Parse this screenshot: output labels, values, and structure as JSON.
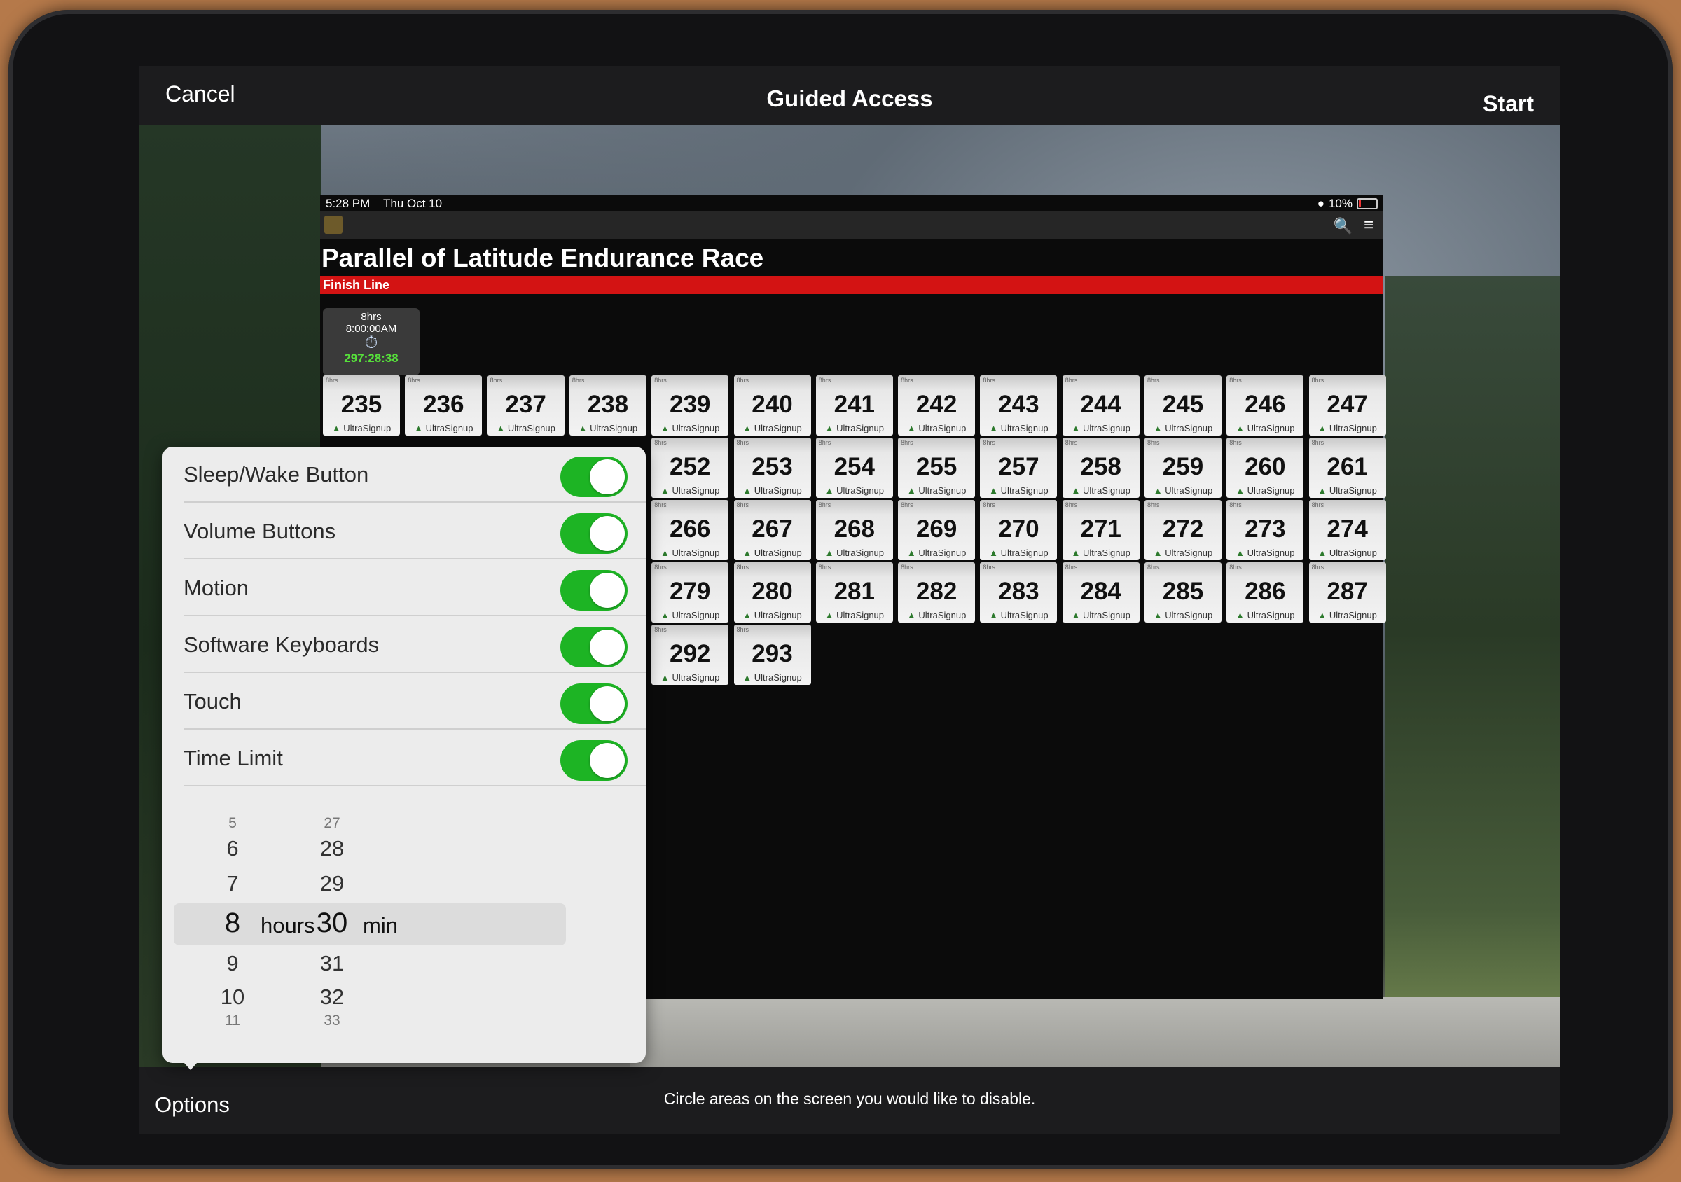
{
  "nav": {
    "cancel": "Cancel",
    "title": "Guided Access",
    "start": "Start"
  },
  "bottom": {
    "options": "Options",
    "hint": "Circle areas on the screen you would like to disable."
  },
  "app": {
    "status_time": "5:28 PM",
    "status_date": "Thu Oct 10",
    "wifi_battery": "10%",
    "race_title": "Parallel of Latitude Endurance Race",
    "section": "Finish Line",
    "timer": {
      "hours": "8hrs",
      "start": "8:00:00AM",
      "elapsed": "297:28:38"
    },
    "tile_tag": "8hrs",
    "tile_brand": "UltraSignup",
    "rows": [
      [
        "235",
        "236",
        "237",
        "238",
        "239",
        "240",
        "241",
        "242",
        "243",
        "244",
        "245",
        "246",
        "247"
      ],
      [
        "",
        "",
        "",
        "",
        "252",
        "253",
        "254",
        "255",
        "257",
        "258",
        "259",
        "260",
        "261"
      ],
      [
        "",
        "",
        "",
        "",
        "266",
        "267",
        "268",
        "269",
        "270",
        "271",
        "272",
        "273",
        "274"
      ],
      [
        "",
        "",
        "",
        "",
        "279",
        "280",
        "281",
        "282",
        "283",
        "284",
        "285",
        "286",
        "287"
      ],
      [
        "",
        "",
        "",
        "",
        "292",
        "293",
        "",
        "",
        "",
        "",
        "",
        "",
        ""
      ]
    ]
  },
  "options": {
    "items": [
      {
        "label": "Sleep/Wake Button",
        "on": true
      },
      {
        "label": "Volume Buttons",
        "on": true
      },
      {
        "label": "Motion",
        "on": true
      },
      {
        "label": "Software Keyboards",
        "on": true
      },
      {
        "label": "Touch",
        "on": true
      },
      {
        "label": "Time Limit",
        "on": true
      }
    ],
    "picker": {
      "hours_above": [
        "5",
        "6",
        "7"
      ],
      "hours_selected": "8",
      "hours_below": [
        "9",
        "10",
        "11"
      ],
      "minutes_above": [
        "27",
        "28",
        "29"
      ],
      "minutes_selected": "30",
      "minutes_below": [
        "31",
        "32",
        "33"
      ],
      "hours_unit": "hours",
      "minutes_unit": "min"
    }
  },
  "colors": {
    "toggle_on": "#1db424",
    "finish_bar": "#d31313",
    "timer_green": "#56e03a"
  }
}
